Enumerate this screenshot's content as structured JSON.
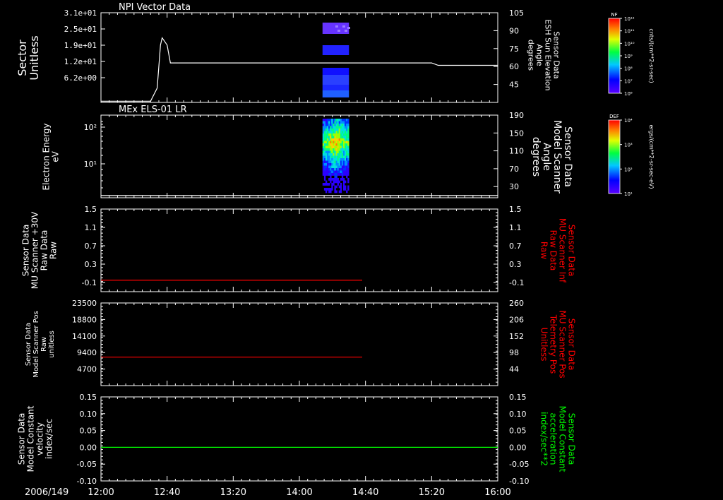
{
  "chart_data": [
    {
      "type": "spectrogram",
      "title": "NPI Vector Data",
      "ylabel_left": [
        "Sector",
        "Unitless"
      ],
      "ylabel_right": [
        "Sensor Data",
        "ESH Sun Elevation",
        "Angle",
        "degrees"
      ],
      "y_ticks_left": [
        "3.1e+01",
        "2.5e+01",
        "1.9e+01",
        "1.2e+01",
        "6.2e+00"
      ],
      "y_ticks_right": [
        "105",
        "90",
        "75",
        "60",
        "45"
      ],
      "yright_range": [
        30,
        105
      ],
      "line_right": {
        "x": [
          "12:00",
          "12:30",
          "12:34",
          "12:36",
          "12:37",
          "12:40",
          "12:42",
          "13:00",
          "14:00",
          "14:40",
          "15:20",
          "15:24",
          "16:00"
        ],
        "y": [
          31,
          31,
          42,
          78,
          84,
          78,
          63,
          63,
          63,
          63,
          63,
          61,
          61
        ],
        "color": "#ffffff"
      },
      "cbar": {
        "label": "NF",
        "ticks": [
          "10¹²",
          "10¹¹",
          "10¹⁰",
          "10⁹",
          "10⁸",
          "10⁷",
          "10⁶"
        ],
        "units": "cnts/(cm**2-sr-sec)"
      }
    },
    {
      "type": "spectrogram",
      "title": "MEx ELS-01 LR",
      "ylabel_left": [
        "Electron Energy",
        "eV"
      ],
      "ylabel_right": [
        "Sensor Data",
        "Model Scanner",
        "Angle",
        "degrees"
      ],
      "y_ticks_left": [
        "10²",
        "10¹"
      ],
      "y_ticks_right": [
        "190",
        "150",
        "110",
        "70",
        "30"
      ],
      "yright_range": [
        5,
        190
      ],
      "line_right": {
        "x": [
          "12:00",
          "16:00"
        ],
        "y": [
          10,
          10
        ],
        "color": "#ffffff"
      },
      "cbar": {
        "label": "DEF",
        "ticks": [
          "10⁴",
          "10³",
          "10²",
          "10¹"
        ],
        "units": "ergs/(cm**2-sr-sec-eV)"
      }
    },
    {
      "type": "line",
      "ylabel_left": [
        "Sensor Data",
        "MU Scanner +30V",
        "Raw Data",
        "Raw"
      ],
      "ylabel_right": [
        "Sensor Data",
        "MU Scanner Inf",
        "Raw Data",
        "Raw"
      ],
      "right_label_color": "#ff0000",
      "y_ticks": [
        "1.5",
        "1.1",
        "0.7",
        "0.3",
        "-0.1"
      ],
      "ylim": [
        -0.3,
        1.5
      ],
      "series": [
        {
          "x": [
            "12:00",
            "14:38"
          ],
          "y": [
            -0.05,
            -0.05
          ],
          "color": "#ff0000"
        }
      ]
    },
    {
      "type": "line",
      "ylabel_left": [
        "Sensor Data",
        "Model Scanner Pos",
        "Raw",
        "unitless"
      ],
      "ylabel_right": [
        "Sensor Data",
        "MU Scanner Pos",
        "Telemetry Pos",
        "Unitless"
      ],
      "right_label_color": "#ff0000",
      "y_ticks_left": [
        "23500",
        "18800",
        "14100",
        "9400",
        "4700"
      ],
      "y_ticks_right": [
        "260",
        "206",
        "152",
        "98",
        "44"
      ],
      "ylim": [
        0,
        23500
      ],
      "series": [
        {
          "x": [
            "12:00",
            "14:38"
          ],
          "y": [
            8100,
            8100
          ],
          "color": "#ff0000"
        }
      ]
    },
    {
      "type": "line",
      "ylabel_left": [
        "Sensor Data",
        "Model Constant",
        "velocity",
        "index/sec"
      ],
      "ylabel_right": [
        "Sensor Data",
        "Model Constant",
        "acceleration",
        "index/sec**2"
      ],
      "right_label_color": "#00ff00",
      "y_ticks": [
        "0.15",
        "0.10",
        "0.05",
        "0.00",
        "-0.05",
        "-0.10"
      ],
      "ylim": [
        -0.1,
        0.15
      ],
      "series": [
        {
          "x": [
            "12:00",
            "16:00"
          ],
          "y": [
            0,
            0
          ],
          "color": "#00ff00"
        }
      ]
    }
  ],
  "x_axis": {
    "date": "2006/149",
    "ticks": [
      "12:00",
      "12:40",
      "13:20",
      "14:00",
      "14:40",
      "15:20",
      "16:00"
    ]
  }
}
